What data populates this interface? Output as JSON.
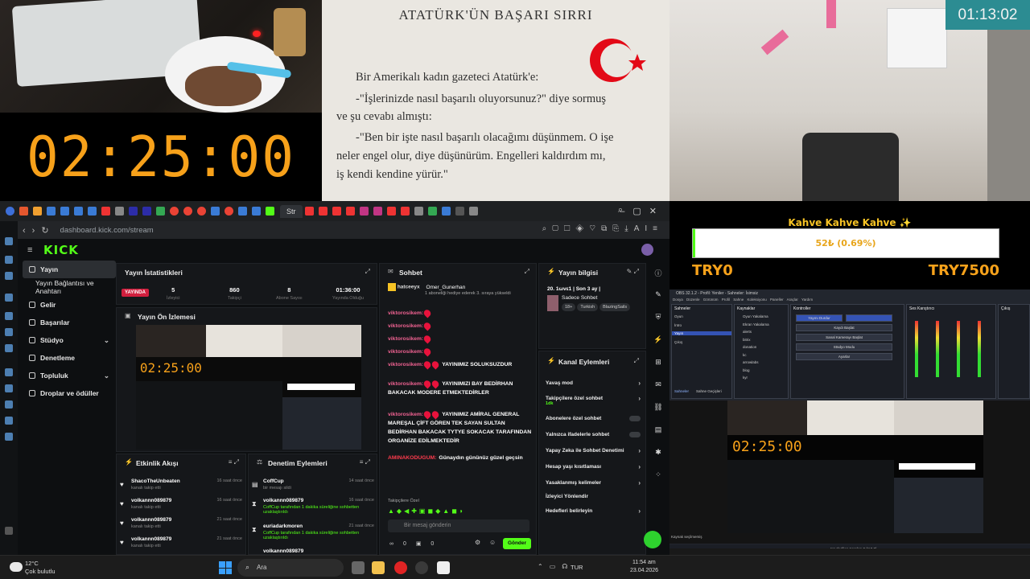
{
  "top": {
    "timer": "02:25:00",
    "room_clock": "01:13:02",
    "book": {
      "title": "ATATÜRK'ÜN BAŞARI SIRRI",
      "lines": [
        "Bir Amerikalı kadın gazeteci Atatürk'e:",
        "-\"İşlerinizde nasıl başarılı oluyorsunuz?\" diye sormuş",
        "ve şu cevabı almıştı:",
        "-\"Ben bir işte nasıl başarılı olacağımı düşünmem. O işe",
        "neler engel olur, diye düşünürüm. Engelleri kaldırdım mı,",
        "iş kendi kendine yürür.\""
      ]
    }
  },
  "browser": {
    "active_tab": "Str",
    "url": "dashboard.kick.com/stream",
    "addr_ai": "AI",
    "logo": "KICK",
    "nav": [
      {
        "label": "Yayın",
        "active": true
      },
      {
        "label": "Yayın Bağlantısı ve Anahtarı",
        "sub": true
      },
      {
        "label": "Gelir"
      },
      {
        "label": "Başarılar"
      },
      {
        "label": "Stüdyo",
        "chevron": true
      },
      {
        "label": "Denetleme"
      },
      {
        "label": "Topluluk",
        "chevron": true
      },
      {
        "label": "Droplar ve ödüller"
      }
    ],
    "stats": {
      "title": "Yayın İstatistikleri",
      "live": "YAYINDA",
      "items": [
        {
          "value": "5",
          "label": "İzleyici"
        },
        {
          "value": "860",
          "label": "Takipçi"
        },
        {
          "value": "8",
          "label": "Abone Sayısı"
        },
        {
          "value": "01:36:00",
          "label": "Yayında Olduğu"
        }
      ]
    },
    "preview": {
      "title": "Yayın Ön İzlemesi",
      "timer": "02:25:00"
    },
    "activity": {
      "title": "Etkinlik Akışı",
      "items": [
        {
          "user": "ShacoTheUnbeaten",
          "action": "kanalı takip etti",
          "when": "16 saat önce"
        },
        {
          "user": "volkannn089879",
          "action": "kanalı takip etti",
          "when": "16 saat önce"
        },
        {
          "user": "volkannn089879",
          "action": "kanalı takip etti",
          "when": "21 saat önce"
        },
        {
          "user": "volkannn089879",
          "action": "kanalı takip etti",
          "when": "21 saat önce"
        }
      ]
    },
    "modlog": {
      "title": "Denetim Eylemleri",
      "items": [
        {
          "user": "CoffCup",
          "action": "bir mesajı sildi",
          "when": "14 saat önce"
        },
        {
          "user": "volkannn089879",
          "action": "CoffCup tarafından 1 dakika süreliğine sohbetten uzaklaştırıldı",
          "when": "16 saat önce"
        },
        {
          "user": "euriadarkmoren",
          "action": "CoffCup tarafından 1 dakika süreliğine sohbetten uzaklaştırıldı",
          "when": "21 saat önce"
        },
        {
          "user": "volkannn089879",
          "action": "",
          "when": ""
        }
      ]
    },
    "chat": {
      "title": "Sohbet",
      "gift_user": "hatceeyx",
      "gift_target": "Omer_Gunerhan",
      "gift_text": "1 aboneliği hediye ederek 3. sıraya yükseldi",
      "messages": [
        {
          "user": "viktorosikem:",
          "text": "",
          "drops": 1
        },
        {
          "user": "viktorosikem:",
          "text": "",
          "drops": 1
        },
        {
          "user": "viktorosikem:",
          "text": "",
          "drops": 1
        },
        {
          "user": "viktorosikem:",
          "text": "",
          "drops": 1
        },
        {
          "user": "viktorosikem:",
          "text": "YAYINIMIZ SOLUKSUZDUR",
          "drops": 2
        },
        {
          "user": "viktorosikem:",
          "text": "YAYINIMIZI BAY BEDİRHAN BAKACAK MODERE ETMEKTEDİRLER",
          "drops": 2
        },
        {
          "user": "viktorosikem:",
          "text": "YAYINIMIZ AMİRAL GENERAL MAREŞAL ÇİFT GÖREN TEK SAYAN SULTAN BEDİRHAN BAKACAK TYTYE SOKACAK TARAFINDAN ORGANİZE EDİLMEKTEDİR",
          "drops": 2
        },
        {
          "user": "AMINAKODUGUM:",
          "text": "Günaydın gününüz güzel geçsin",
          "drops": 0
        }
      ],
      "followers_only": "Takipçilere Özel",
      "placeholder": "Bir mesaj gönderin",
      "points": "0",
      "count": "0",
      "send": "Gönder"
    },
    "info": {
      "title": "Yayın bilgisi",
      "stream_title": "20. 1ωvε1 | Son 3 ay |",
      "category": "Sadece Sohbet",
      "tags": [
        "18+",
        "Turkish",
        "BlazingSails"
      ]
    },
    "channel_actions": {
      "title": "Kanal Eylemleri",
      "items": [
        {
          "label": "Yavaş mod",
          "kind": "arrow"
        },
        {
          "label": "Takipçilere özel sohbet",
          "sub": "1dk",
          "kind": "arrow"
        },
        {
          "label": "Abonelere özel sohbet",
          "kind": "toggle"
        },
        {
          "label": "Yalnızca ifadelerle sohbet",
          "kind": "toggle"
        },
        {
          "label": "Yapay Zeka ile Sohbet Denetimi",
          "kind": "arrow"
        },
        {
          "label": "Hesap yaşı kısıtlaması",
          "kind": "arrow"
        },
        {
          "label": "Yasaklanmış kelimeler",
          "kind": "arrow"
        },
        {
          "label": "İzleyici Yönlendir",
          "kind": "none"
        },
        {
          "label": "Hedefleri belirleyin",
          "kind": "arrow"
        }
      ]
    }
  },
  "donation": {
    "title": "Kahve Kahve Kahve ✨",
    "amount": "52₺ (0.69%)",
    "progress_percent": 0.69,
    "min": "TRY0",
    "max": "TRY7500"
  },
  "obs": {
    "title": "OBS 32.1.2 - Profil: Yeniler - Sahneler: İsimsiz",
    "menu": "Dosya Düzenle Görünüm Profil Sahne Koleksiyonu Paneller Araçlar Yardım",
    "scenes_title": "Sahneler",
    "scenes": [
      "Oyun",
      "İntro",
      "Yayın",
      "Çıkış"
    ],
    "sources_title": "Kaynaklar",
    "sources": [
      "Oyun Yakalama",
      "Ekran Yakalama",
      "alerts",
      "bitrix",
      "donation",
      "kc",
      "arrowlabs",
      "blog",
      "kyr"
    ],
    "controls_title": "Kontroller",
    "controls": [
      "Yayını Durdur",
      "Kaydı Başlat",
      "Sanal Kamerayı Başlat",
      "Stüdyo Modu",
      "Ayarlar"
    ],
    "mixer_title": "Ses Karıştırıcı",
    "chat_title": "Çıkış",
    "status": "Kaydedilen Kareler: 0 (%0.0)",
    "tabs": [
      "Sahneler",
      "Sahne Geçişleri"
    ],
    "source_note": "Kaynak seçilmemiş"
  },
  "taskbar": {
    "temp": "12°C",
    "weather": "Çok bulutlu",
    "search": "Ara",
    "lang": "TUR",
    "time": "11:54 am",
    "date": "23.04.2026"
  }
}
